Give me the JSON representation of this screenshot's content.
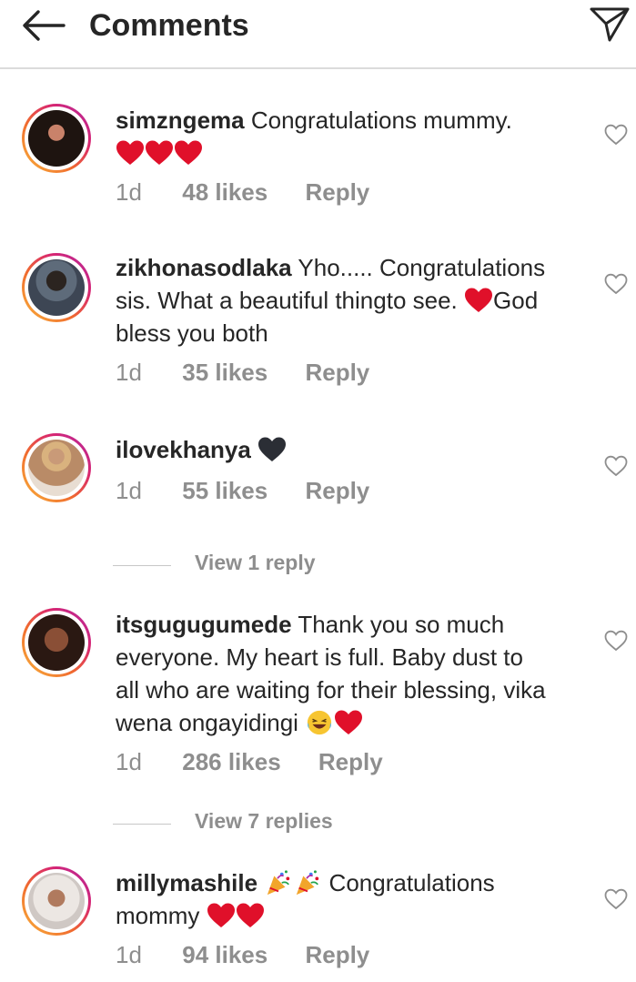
{
  "header": {
    "title": "Comments"
  },
  "comments": [
    {
      "username": "simzngema",
      "text": "Congratulations mummy.",
      "time": "1d",
      "likes": "48 likes",
      "reply": "Reply"
    },
    {
      "username": "zikhonasodlaka",
      "text_a": "Yho..... Congratulations",
      "text_b": "sis. What a beautiful thingto see.",
      "text_c": "God",
      "text_d": "bless you both",
      "time": "1d",
      "likes": "35 likes",
      "reply": "Reply"
    },
    {
      "username": "ilovekhanya",
      "text": "",
      "time": "1d",
      "likes": "55 likes",
      "reply": "Reply"
    },
    {
      "username": "itsgugugumede",
      "text_a": "Thank you so much",
      "text_b": "everyone. My heart is full. Baby dust to",
      "text_c": "all who are waiting for their blessing, vika",
      "text_d": "wena ongayidingi",
      "time": "1d",
      "likes": "286 likes",
      "reply": "Reply"
    },
    {
      "username": "millymashile",
      "text_a": "Congratulations",
      "text_b": "mommy",
      "time": "1d",
      "likes": "94 likes",
      "reply": "Reply"
    }
  ],
  "view_replies": [
    "View 1 reply",
    "View 7 replies"
  ],
  "colors": {
    "text": "#262626",
    "muted": "#8e8e8e",
    "heart": "#e0102a",
    "ring": "#d8256f"
  },
  "icons": [
    "back-arrow-icon",
    "send-icon",
    "heart-outline-icon",
    "red-heart-emoji",
    "black-heart-emoji",
    "laughing-emoji",
    "party-popper-emoji"
  ]
}
